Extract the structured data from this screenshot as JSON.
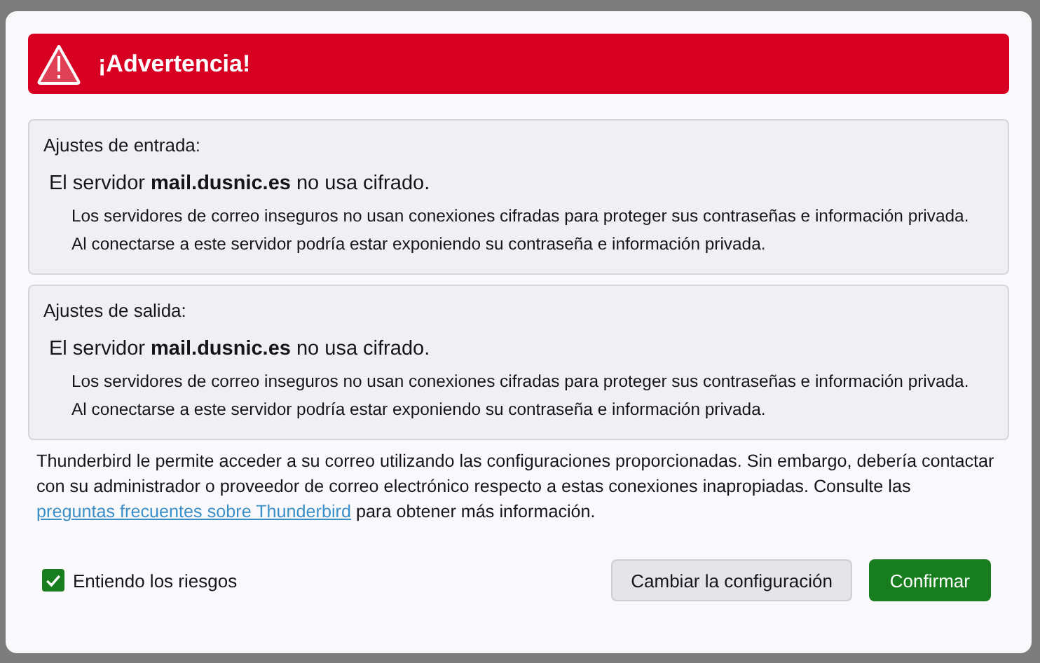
{
  "dialog": {
    "title": "¡Advertencia!"
  },
  "sections": [
    {
      "heading": "Ajustes de entrada:",
      "message": "El servidor **mail.dusnic.es** no usa cifrado.",
      "detail": "Los servidores de correo inseguros no usan conexiones cifradas para proteger sus contraseñas e información privada. Al conectarse a este servidor podría estar exponiendo su contraseña e información privada."
    },
    {
      "heading": "Ajustes de salida:",
      "message": "El servidor **mail.dusnic.es** no usa cifrado.",
      "detail": "Los servidores de correo inseguros no usan conexiones cifradas para proteger sus contraseñas e información privada. Al conectarse a este servidor podría estar exponiendo su contraseña e información privada."
    }
  ],
  "footer": {
    "text_before": "Thunderbird le permite acceder a su correo utilizando las configuraciones proporcionadas. Sin embargo, debería contactar con su administrador o proveedor de correo electrónico respecto a estas conexiones inapropiadas. Consulte las",
    "link": "preguntas frecuentes sobre Thunderbird",
    "text_after": "para obtener más información."
  },
  "checkbox": {
    "label": "Entiendo los riesgos",
    "checked": true
  },
  "buttons": [
    {
      "label": "Cambiar la configuración",
      "kind": "secondary"
    },
    {
      "label": "Confirmar",
      "kind": "primary"
    }
  ]
}
